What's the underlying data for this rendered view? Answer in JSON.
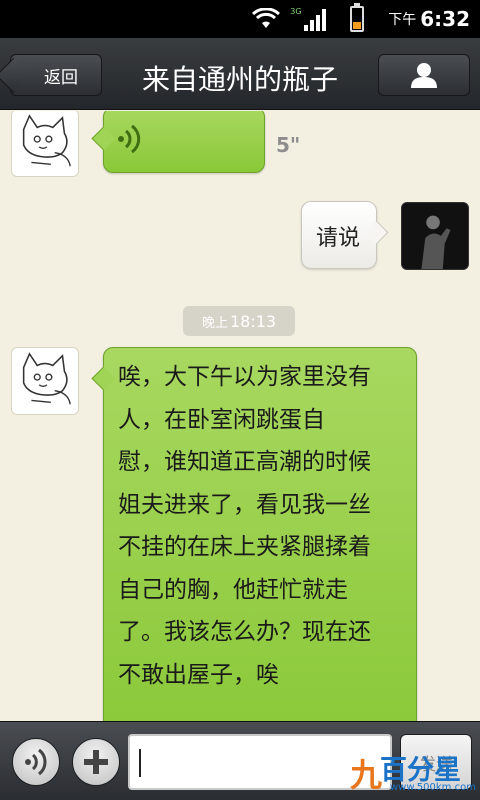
{
  "status_bar": {
    "network_type": "3G",
    "time_prefix": "下午",
    "time": "6:32"
  },
  "header": {
    "back_label": "返回",
    "title": "来自通州的瓶子"
  },
  "messages": {
    "voice": {
      "duration": "5\""
    },
    "reply": {
      "text": "请说"
    },
    "timestamp": {
      "prefix": "晚上",
      "time": "18:13"
    },
    "long": {
      "lines": [
        "唉，大下午以为家里没有",
        "人，在卧室闲跳蛋自",
        "慰，谁知道正高潮的时候",
        "姐夫进来了，看见我一丝",
        "不挂的在床上夹紧腿揉着",
        "自己的胸，他赶忙就走",
        "了。我该怎么办？现在还",
        "不敢出屋子，唉"
      ]
    }
  },
  "input_bar": {
    "input_value": "",
    "send_label": "发送"
  },
  "watermark": {
    "text": "百分星",
    "mark": "九",
    "url": "www.500km.com"
  },
  "colors": {
    "green_bubble": "#9bd04b",
    "battery": "#f39c1e",
    "title_bar": "#2e3135"
  }
}
